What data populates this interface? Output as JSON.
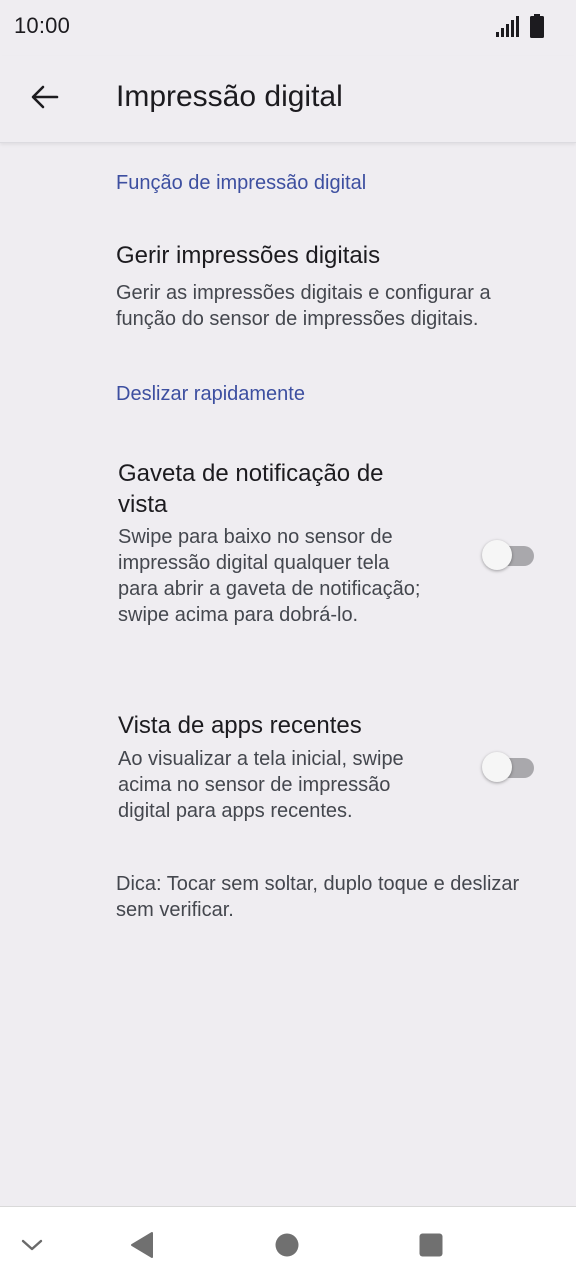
{
  "status_bar": {
    "time": "10:00",
    "icons": [
      "signal-icon",
      "battery-icon"
    ]
  },
  "app_bar": {
    "back_icon": "arrow-left-icon",
    "title": "Impressão digital"
  },
  "sections": {
    "fingerprint_function": {
      "header": "Função de impressão digital",
      "manage": {
        "title": "Gerir impressões digitais",
        "summary": "Gerir as impressões digitais e configurar a função do sensor de impressões digitais."
      }
    },
    "quick_swipe": {
      "header": "Deslizar rapidamente",
      "notification_drawer": {
        "title": "Gaveta de notificação de vista",
        "summary": "Swipe para baixo no sensor de impressão digital qualquer tela para abrir a gaveta de notificação; swipe acima para dobrá-lo.",
        "enabled": false
      },
      "recent_apps": {
        "title": "Vista de apps recentes",
        "summary": "Ao visualizar a tela inicial, swipe acima no sensor de impressão digital para apps recentes.",
        "enabled": false
      },
      "tip": "Dica: Tocar sem soltar, duplo toque e deslizar sem verificar."
    }
  },
  "nav_bar": {
    "icons": [
      "chevron-down-icon",
      "back-triangle-icon",
      "home-circle-icon",
      "recents-square-icon"
    ]
  },
  "colors": {
    "background": "#efedf1",
    "accent": "#3d4fa0",
    "toggle_track_off": "#a9a8ac"
  }
}
